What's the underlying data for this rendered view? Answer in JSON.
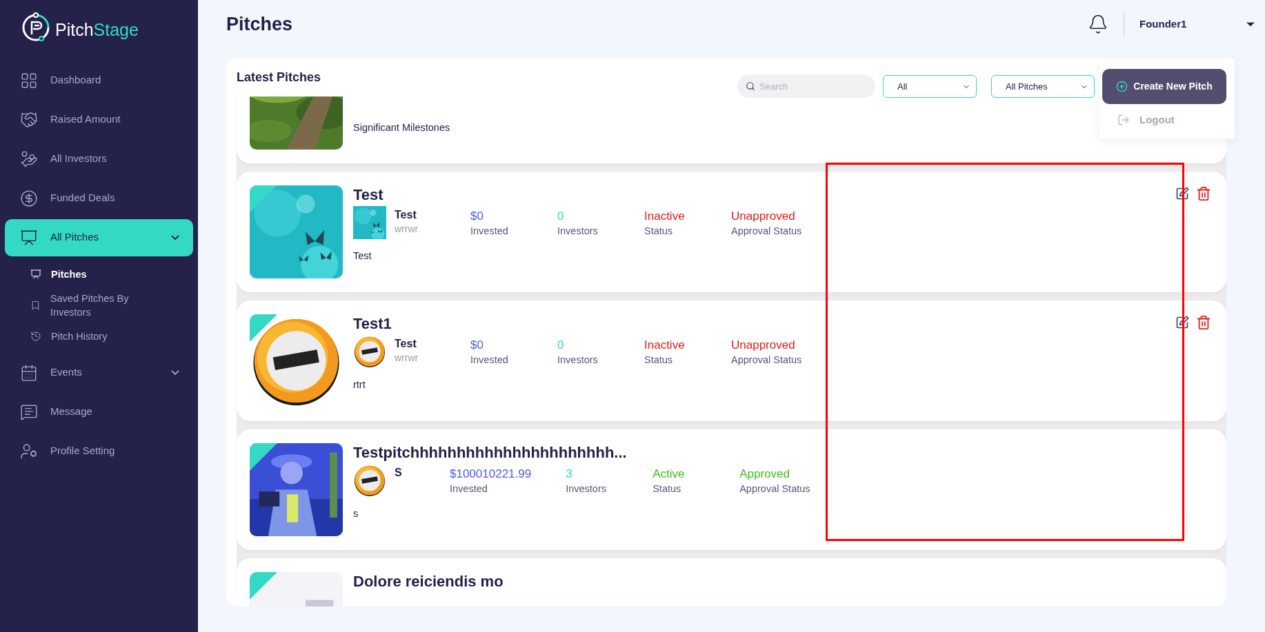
{
  "sidebar": {
    "logo": [
      "Pitch",
      "Stage"
    ],
    "items": [
      {
        "label": "Dashboard",
        "selected": false
      },
      {
        "label": "Raised Amount",
        "selected": false
      },
      {
        "label": "All Investors",
        "selected": false
      },
      {
        "label": "Funded Deals",
        "selected": false
      },
      {
        "label": "All Pitches",
        "selected": true,
        "expanded": true,
        "children": [
          {
            "label": "Pitches",
            "selected": true
          },
          {
            "label": "Saved Pitches By Investors",
            "selected": false
          },
          {
            "label": "Pitch History",
            "selected": false
          }
        ]
      },
      {
        "label": "Events",
        "selected": false,
        "expanded": false
      },
      {
        "label": "Message",
        "selected": false
      },
      {
        "label": "Profile Setting",
        "selected": false
      }
    ]
  },
  "header": {
    "title": "Pitches",
    "user": "Founder1"
  },
  "user_menu": {
    "items": [
      "Logout"
    ]
  },
  "panel": {
    "title": "Latest Pitches",
    "search": {
      "placeholder": "Search"
    },
    "filters": [
      "All",
      "All Pitches"
    ],
    "create_button": "Create New Pitch"
  },
  "pitches": [
    {
      "description": "Significant Milestones"
    },
    {
      "title": "Test",
      "owner": {
        "name": "Test",
        "subtitle": "wrrwr"
      },
      "stats": [
        {
          "kind": "invested",
          "value": "$0",
          "label": "Invested"
        },
        {
          "kind": "investors",
          "value": "0",
          "label": "Investors"
        },
        {
          "kind": "status",
          "value": "Inactive",
          "label": "Status",
          "positive": false
        },
        {
          "kind": "status",
          "value": "Unapproved",
          "label": "Approval Status",
          "positive": false
        }
      ],
      "description": "Test",
      "editable": true
    },
    {
      "title": "Test1",
      "owner": {
        "name": "Test",
        "subtitle": "wrrwr"
      },
      "stats": [
        {
          "kind": "invested",
          "value": "$0",
          "label": "Invested"
        },
        {
          "kind": "investors",
          "value": "0",
          "label": "Investors"
        },
        {
          "kind": "status",
          "value": "Inactive",
          "label": "Status",
          "positive": false
        },
        {
          "kind": "status",
          "value": "Unapproved",
          "label": "Approval Status",
          "positive": false
        }
      ],
      "description": "rtrt",
      "editable": true
    },
    {
      "title": "Testpitchhhhhhhhhhhhhhhhhhhhhh...",
      "owner": {
        "name": "S"
      },
      "stats": [
        {
          "kind": "invested",
          "value": "$100010221.99",
          "label": "Invested"
        },
        {
          "kind": "investors",
          "value": "3",
          "label": "Investors"
        },
        {
          "kind": "status",
          "value": "Active",
          "label": "Status",
          "positive": true
        },
        {
          "kind": "status",
          "value": "Approved",
          "label": "Approval Status",
          "positive": true
        }
      ],
      "description": "s",
      "editable": false
    },
    {
      "title": "Dolore reiciendis mo"
    }
  ]
}
